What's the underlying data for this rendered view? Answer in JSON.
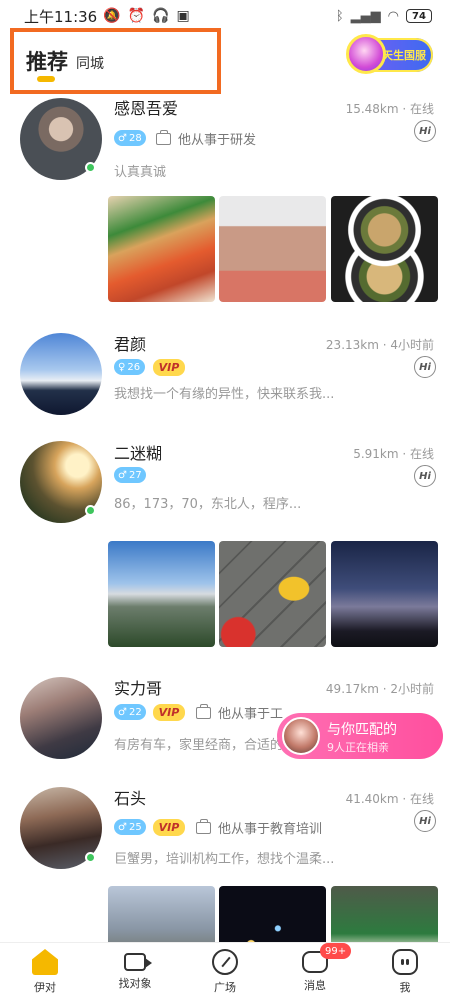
{
  "status_bar": {
    "time": "上午11:36",
    "battery": "74"
  },
  "tabs": {
    "recommend": "推荐",
    "same_city": "同城"
  },
  "promo": {
    "label": "天生国服"
  },
  "feed": [
    {
      "name": "感恩吾爱",
      "distance": "15.48km · 在线",
      "age": "28",
      "job": "他从事于研发",
      "bio": "认真真诚",
      "online": true
    },
    {
      "name": "君颜",
      "distance": "23.13km · 4小时前",
      "age": "26",
      "vip": "VIP",
      "bio": "我想找一个有缘的异性，快来联系我...",
      "online": false
    },
    {
      "name": "二迷糊",
      "distance": "5.91km · 在线",
      "age": "27",
      "bio": "86，173，70，东北人，程序...",
      "online": true
    },
    {
      "name": "实力哥",
      "distance": "49.17km · 2小时前",
      "age": "22",
      "vip": "VIP",
      "job": "他从事于工",
      "bio": "有房有车，家里经商，合适的",
      "online": false
    },
    {
      "name": "石头",
      "distance": "41.40km · 在线",
      "age": "25",
      "vip": "VIP",
      "job": "他从事于教育培训",
      "bio": "巨蟹男，培训机构工作，想找个温柔...",
      "online": true
    }
  ],
  "match": {
    "title": "与你匹配的",
    "subtitle": "9人正在相亲"
  },
  "bottom_nav": [
    {
      "label": "伊对",
      "icon": "home-icon",
      "active": true
    },
    {
      "label": "找对象",
      "icon": "video-icon"
    },
    {
      "label": "广场",
      "icon": "compass-icon"
    },
    {
      "label": "消息",
      "icon": "message-icon",
      "badge": "99+"
    },
    {
      "label": "我",
      "icon": "profile-icon"
    }
  ],
  "colors": {
    "accent": "#f5b800",
    "highlight_border": "#f26a21",
    "online": "#3ec55d",
    "match_pink": "#ff5aa5",
    "age_tag": "#6fc7ff"
  }
}
